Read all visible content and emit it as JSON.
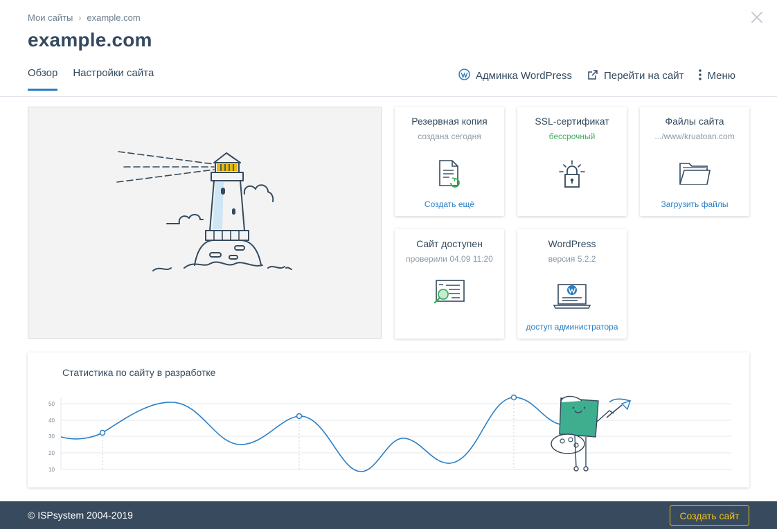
{
  "breadcrumb": {
    "root": "Мои сайты",
    "separator": "›",
    "current": "example.com"
  },
  "title": "example.com",
  "tabs": [
    {
      "label": "Обзор",
      "active": true
    },
    {
      "label": "Настройки сайта",
      "active": false
    }
  ],
  "actions": {
    "wp_admin": "Админка WordPress",
    "goto_site": "Перейти на сайт",
    "menu": "Меню"
  },
  "cards": {
    "backup": {
      "title": "Резервная копия",
      "subtitle": "создана сегодня",
      "link": "Создать ещё",
      "icon": "document-refresh-icon"
    },
    "ssl": {
      "title": "SSL-сертификат",
      "subtitle": "бессрочный",
      "icon": "padlock-icon"
    },
    "files": {
      "title": "Файлы сайта",
      "subtitle": ".../www/kruatoan.com",
      "link": "Загрузить файлы",
      "icon": "folder-icon"
    },
    "availability": {
      "title": "Сайт доступен",
      "subtitle": "проверили 04.09 11:20",
      "icon": "magnifier-page-icon"
    },
    "wordpress": {
      "title": "WordPress",
      "subtitle": "версия 5.2.2",
      "link": "доступ администратора",
      "icon": "wordpress-laptop-icon"
    }
  },
  "stats": {
    "title": "Статистика по сайту в разработке",
    "y_ticks": [
      "50",
      "40",
      "30",
      "20",
      "10"
    ]
  },
  "footer": {
    "copyright": "© ISPsystem 2004-2019",
    "create_button": "Создать сайт"
  },
  "colors": {
    "accent": "#2b7fc4",
    "success": "#3fae5c",
    "footer_bg": "#384a5d",
    "button_yellow": "#f0c419"
  }
}
